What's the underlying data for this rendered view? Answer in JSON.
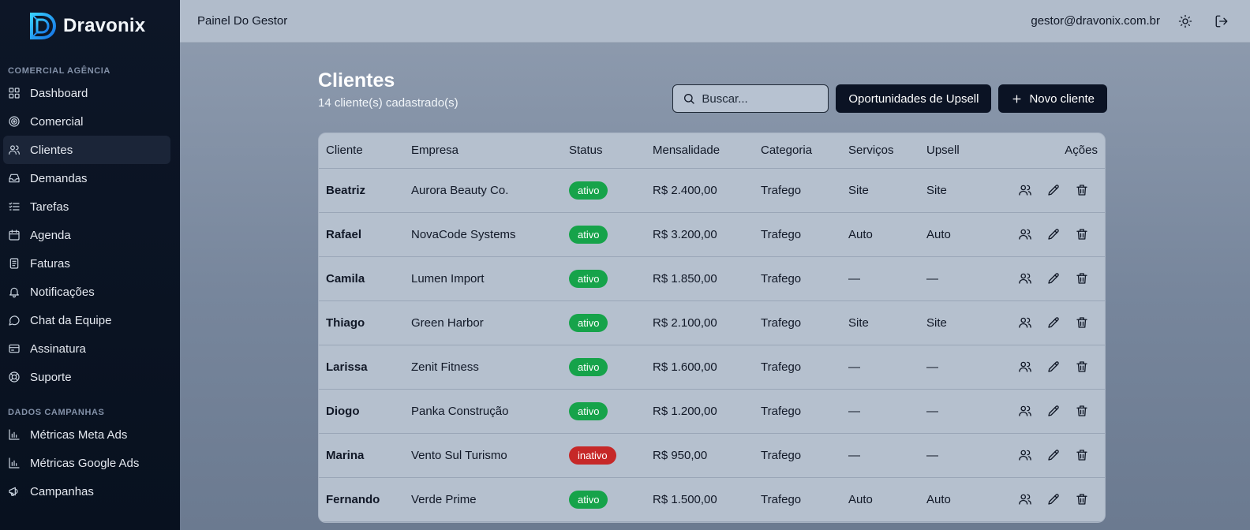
{
  "brand": {
    "name": "Dravonix"
  },
  "sidebar": {
    "sections": [
      {
        "title": "COMERCIAL AGÊNCIA",
        "items": [
          {
            "label": "Dashboard",
            "icon": "grid-icon"
          },
          {
            "label": "Comercial",
            "icon": "target-icon"
          },
          {
            "label": "Clientes",
            "icon": "users-icon",
            "active": true
          },
          {
            "label": "Demandas",
            "icon": "inbox-icon"
          },
          {
            "label": "Tarefas",
            "icon": "checklist-icon"
          },
          {
            "label": "Agenda",
            "icon": "calendar-icon"
          },
          {
            "label": "Faturas",
            "icon": "receipt-icon"
          },
          {
            "label": "Notificações",
            "icon": "bell-icon"
          },
          {
            "label": "Chat da Equipe",
            "icon": "chat-icon"
          },
          {
            "label": "Assinatura",
            "icon": "card-icon"
          },
          {
            "label": "Suporte",
            "icon": "lifebuoy-icon"
          }
        ]
      },
      {
        "title": "DADOS CAMPANHAS",
        "items": [
          {
            "label": "Métricas Meta Ads",
            "icon": "bar-chart-icon"
          },
          {
            "label": "Métricas Google Ads",
            "icon": "bar-chart-icon"
          },
          {
            "label": "Campanhas",
            "icon": "megaphone-icon"
          }
        ]
      }
    ]
  },
  "topbar": {
    "title": "Painel Do Gestor",
    "user_email": "gestor@dravonix.com.br",
    "theme_icon": "sun-icon",
    "logout_icon": "logout-icon"
  },
  "page": {
    "title": "Clientes",
    "subtitle": "14 cliente(s) cadastrado(s)",
    "search_placeholder": "Buscar...",
    "upsell_button": "Oportunidades de Upsell",
    "new_button": "Novo cliente"
  },
  "table": {
    "headers": {
      "cliente": "Cliente",
      "empresa": "Empresa",
      "status": "Status",
      "mensalidade": "Mensalidade",
      "categoria": "Categoria",
      "servicos": "Serviços",
      "upsell": "Upsell",
      "acoes": "Ações"
    },
    "rows": [
      {
        "cliente": "Beatriz",
        "empresa": "Aurora Beauty Co.",
        "status": "ativo",
        "mensalidade": "R$ 2.400,00",
        "categoria": "Trafego",
        "servicos": "Site",
        "upsell": "Site"
      },
      {
        "cliente": "Rafael",
        "empresa": "NovaCode Systems",
        "status": "ativo",
        "mensalidade": "R$ 3.200,00",
        "categoria": "Trafego",
        "servicos": "Auto",
        "upsell": "Auto"
      },
      {
        "cliente": "Camila",
        "empresa": "Lumen Import",
        "status": "ativo",
        "mensalidade": "R$ 1.850,00",
        "categoria": "Trafego",
        "servicos": "—",
        "upsell": "—"
      },
      {
        "cliente": "Thiago",
        "empresa": "Green Harbor",
        "status": "ativo",
        "mensalidade": "R$ 2.100,00",
        "categoria": "Trafego",
        "servicos": "Site",
        "upsell": "Site"
      },
      {
        "cliente": "Larissa",
        "empresa": "Zenit Fitness",
        "status": "ativo",
        "mensalidade": "R$ 1.600,00",
        "categoria": "Trafego",
        "servicos": "—",
        "upsell": "—"
      },
      {
        "cliente": "Diogo",
        "empresa": "Panka Construção",
        "status": "ativo",
        "mensalidade": "R$ 1.200,00",
        "categoria": "Trafego",
        "servicos": "—",
        "upsell": "—"
      },
      {
        "cliente": "Marina",
        "empresa": "Vento Sul Turismo",
        "status": "inativo",
        "mensalidade": "R$ 950,00",
        "categoria": "Trafego",
        "servicos": "—",
        "upsell": "—"
      },
      {
        "cliente": "Fernando",
        "empresa": "Verde Prime",
        "status": "ativo",
        "mensalidade": "R$ 1.500,00",
        "categoria": "Trafego",
        "servicos": "Auto",
        "upsell": "Auto"
      }
    ],
    "row_action_icons": [
      "user-icon",
      "pencil-icon",
      "trash-icon"
    ]
  },
  "colors": {
    "sidebar_bg": "#0b1424",
    "topbar_bg": "#b1bccb",
    "primary_button": "#0b1324",
    "status_active": "#16a34a",
    "status_inactive": "#c62828",
    "logo_accent": "#22b8f0"
  }
}
